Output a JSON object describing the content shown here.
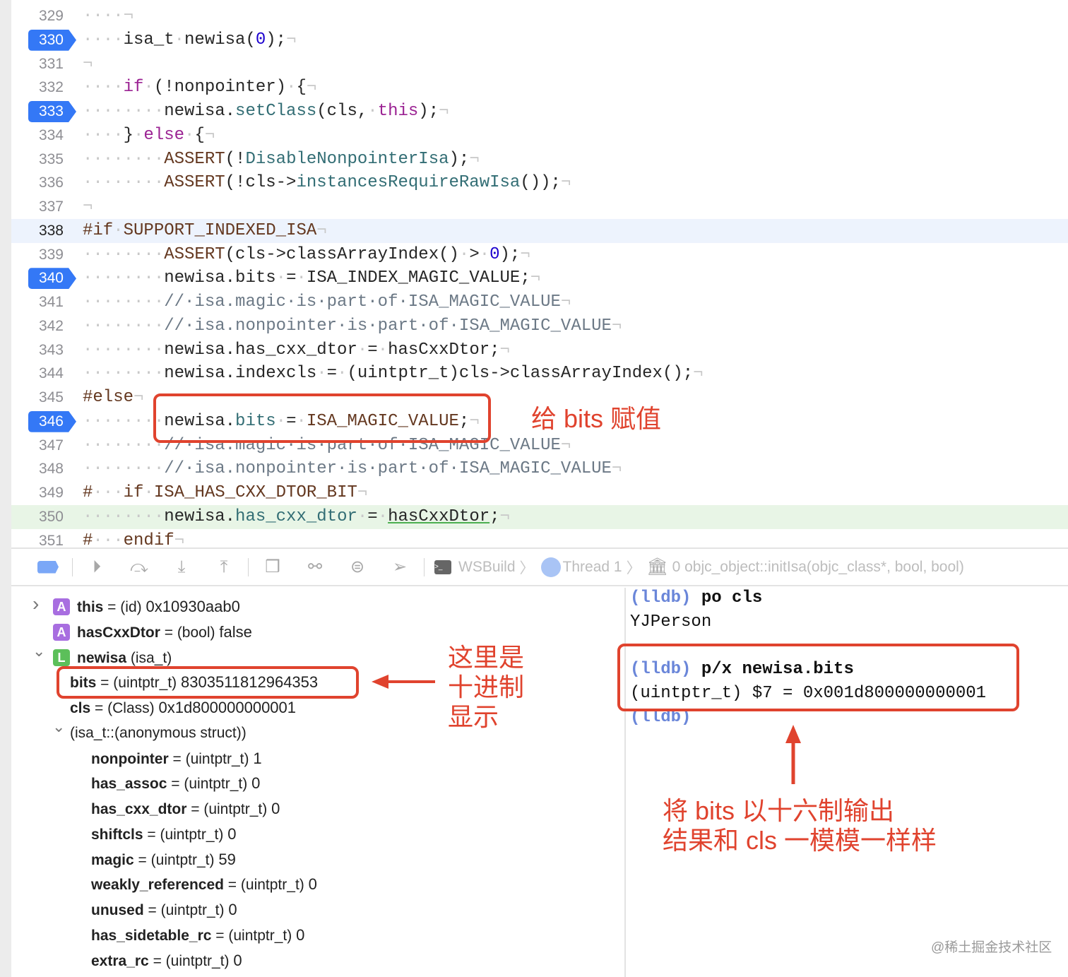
{
  "colors": {
    "accent": "#3478f6",
    "annotation": "#e0432e",
    "keyword": "#9b2393",
    "function": "#326d74",
    "number": "#1c00cf",
    "macro": "#643820",
    "comment": "#6c7986",
    "lldb_prompt": "#6a86d9"
  },
  "editor": {
    "lines": [
      {
        "n": "329",
        "t": [
          [
            "w",
            "····"
          ],
          [
            "e",
            "¬"
          ]
        ]
      },
      {
        "n": "330",
        "bp": true,
        "t": [
          [
            "w",
            "····"
          ],
          [
            "p",
            "isa_t"
          ],
          [
            "w",
            "·"
          ],
          [
            "p",
            "newisa("
          ],
          [
            "n",
            "0"
          ],
          [
            "p",
            ");"
          ],
          [
            "e",
            "¬"
          ]
        ]
      },
      {
        "n": "331",
        "t": [
          [
            "e",
            "¬"
          ]
        ]
      },
      {
        "n": "332",
        "t": [
          [
            "w",
            "····"
          ],
          [
            "k",
            "if"
          ],
          [
            "w",
            "·"
          ],
          [
            "p",
            "(!nonpointer)"
          ],
          [
            "w",
            "·"
          ],
          [
            "p",
            "{"
          ],
          [
            "e",
            "¬"
          ]
        ]
      },
      {
        "n": "333",
        "bp": true,
        "t": [
          [
            "w",
            "········"
          ],
          [
            "p",
            "newisa."
          ],
          [
            "f",
            "setClass"
          ],
          [
            "p",
            "(cls,"
          ],
          [
            "w",
            "·"
          ],
          [
            "k",
            "this"
          ],
          [
            "p",
            ");"
          ],
          [
            "e",
            "¬"
          ]
        ]
      },
      {
        "n": "334",
        "t": [
          [
            "w",
            "····"
          ],
          [
            "p",
            "}"
          ],
          [
            "w",
            "·"
          ],
          [
            "k",
            "else"
          ],
          [
            "w",
            "·"
          ],
          [
            "p",
            "{"
          ],
          [
            "e",
            "¬"
          ]
        ]
      },
      {
        "n": "335",
        "t": [
          [
            "w",
            "········"
          ],
          [
            "m",
            "ASSERT"
          ],
          [
            "p",
            "(!"
          ],
          [
            "f",
            "DisableNonpointerIsa"
          ],
          [
            "p",
            ");"
          ],
          [
            "e",
            "¬"
          ]
        ]
      },
      {
        "n": "336",
        "t": [
          [
            "w",
            "········"
          ],
          [
            "m",
            "ASSERT"
          ],
          [
            "p",
            "(!cls->"
          ],
          [
            "f",
            "instancesRequireRawIsa"
          ],
          [
            "p",
            "());"
          ],
          [
            "e",
            "¬"
          ]
        ]
      },
      {
        "n": "337",
        "t": [
          [
            "e",
            "¬"
          ]
        ]
      },
      {
        "n": "338",
        "hl": "blue",
        "cur": true,
        "t": [
          [
            "m",
            "#if"
          ],
          [
            "w",
            "·"
          ],
          [
            "m",
            "SUPPORT_INDEXED_ISA"
          ],
          [
            "e",
            "¬"
          ]
        ]
      },
      {
        "n": "339",
        "t": [
          [
            "w",
            "········"
          ],
          [
            "m",
            "ASSERT"
          ],
          [
            "p",
            "(cls->classArrayIndex()"
          ],
          [
            "w",
            "·"
          ],
          [
            "p",
            ">"
          ],
          [
            "w",
            "·"
          ],
          [
            "n",
            "0"
          ],
          [
            "p",
            ");"
          ],
          [
            "e",
            "¬"
          ]
        ]
      },
      {
        "n": "340",
        "bp": true,
        "t": [
          [
            "w",
            "········"
          ],
          [
            "p",
            "newisa.bits"
          ],
          [
            "w",
            "·"
          ],
          [
            "p",
            "="
          ],
          [
            "w",
            "·"
          ],
          [
            "p",
            "ISA_INDEX_MAGIC_VALUE;"
          ],
          [
            "e",
            "¬"
          ]
        ]
      },
      {
        "n": "341",
        "t": [
          [
            "w",
            "········"
          ],
          [
            "c",
            "//·isa.magic·is·part·of·ISA_MAGIC_VALUE"
          ],
          [
            "e",
            "¬"
          ]
        ]
      },
      {
        "n": "342",
        "t": [
          [
            "w",
            "········"
          ],
          [
            "c",
            "//·isa.nonpointer·is·part·of·ISA_MAGIC_VALUE"
          ],
          [
            "e",
            "¬"
          ]
        ]
      },
      {
        "n": "343",
        "t": [
          [
            "w",
            "········"
          ],
          [
            "p",
            "newisa.has_cxx_dtor"
          ],
          [
            "w",
            "·"
          ],
          [
            "p",
            "="
          ],
          [
            "w",
            "·"
          ],
          [
            "p",
            "hasCxxDtor;"
          ],
          [
            "e",
            "¬"
          ]
        ]
      },
      {
        "n": "344",
        "t": [
          [
            "w",
            "········"
          ],
          [
            "p",
            "newisa.indexcls"
          ],
          [
            "w",
            "·"
          ],
          [
            "p",
            "="
          ],
          [
            "w",
            "·"
          ],
          [
            "p",
            "(uintptr_t)cls->classArrayIndex();"
          ],
          [
            "e",
            "¬"
          ]
        ]
      },
      {
        "n": "345",
        "t": [
          [
            "m",
            "#else"
          ],
          [
            "e",
            "¬"
          ]
        ]
      },
      {
        "n": "346",
        "bp": true,
        "t": [
          [
            "w",
            "········"
          ],
          [
            "p",
            "newisa."
          ],
          [
            "f",
            "bits"
          ],
          [
            "w",
            "·"
          ],
          [
            "p",
            "="
          ],
          [
            "w",
            "·"
          ],
          [
            "m",
            "ISA_MAGIC_VALUE"
          ],
          [
            "p",
            ";"
          ],
          [
            "e",
            "¬"
          ]
        ]
      },
      {
        "n": "347",
        "t": [
          [
            "w",
            "········"
          ],
          [
            "c",
            "//·isa.magic·is·part·of·ISA_MAGIC_VALUE"
          ],
          [
            "e",
            "¬"
          ]
        ]
      },
      {
        "n": "348",
        "t": [
          [
            "w",
            "········"
          ],
          [
            "c",
            "//·isa.nonpointer·is·part·of·ISA_MAGIC_VALUE"
          ],
          [
            "e",
            "¬"
          ]
        ]
      },
      {
        "n": "349",
        "t": [
          [
            "m",
            "#"
          ],
          [
            "w",
            "···"
          ],
          [
            "m",
            "if"
          ],
          [
            "w",
            "·"
          ],
          [
            "m",
            "ISA_HAS_CXX_DTOR_BIT"
          ],
          [
            "e",
            "¬"
          ]
        ]
      },
      {
        "n": "350",
        "hl": "green",
        "t": [
          [
            "w",
            "········"
          ],
          [
            "p",
            "newisa."
          ],
          [
            "f",
            "has_cxx_dtor"
          ],
          [
            "w",
            "·"
          ],
          [
            "p",
            "="
          ],
          [
            "w",
            "·"
          ],
          [
            "u",
            "hasCxxDtor"
          ],
          [
            "p",
            ";"
          ],
          [
            "e",
            "¬"
          ]
        ]
      },
      {
        "n": "351",
        "t": [
          [
            "m",
            "#"
          ],
          [
            "w",
            "···"
          ],
          [
            "m",
            "endif"
          ],
          [
            "e",
            "¬"
          ]
        ]
      }
    ]
  },
  "toolbar": {
    "icons": [
      "breakpoints-toggle-icon",
      "continue-icon",
      "step-over-icon",
      "step-into-icon",
      "step-out-icon",
      "view-hierarchy-icon",
      "memory-graph-icon",
      "environment-overrides-icon",
      "simulate-location-icon"
    ],
    "target": "WSBuild",
    "thread": "Thread 1",
    "frame": "0 objc_object::initIsa(objc_class*, bool, bool)"
  },
  "variables": [
    {
      "level": 0,
      "disc": "›",
      "badge": "A",
      "badge_color": "#a86ee0",
      "name": "this",
      "type": "(id)",
      "value": "0x10930aab0"
    },
    {
      "level": 0,
      "badge": "A",
      "badge_color": "#a86ee0",
      "name": "hasCxxDtor",
      "type": "(bool)",
      "value": "false"
    },
    {
      "level": 0,
      "disc": "⌄",
      "badge": "L",
      "badge_color": "#5cbf5a",
      "name": "newisa",
      "type": "(isa_t)",
      "value": ""
    },
    {
      "level": 1,
      "name": "bits",
      "type": "(uintptr_t)",
      "value": "8303511812964353"
    },
    {
      "level": 1,
      "name": "cls",
      "type": "(Class)",
      "value": "0x1d800000000001"
    },
    {
      "level": 1,
      "disc": "⌄",
      "plain": "(isa_t::(anonymous struct))"
    },
    {
      "level": 2,
      "name": "nonpointer",
      "type": "(uintptr_t)",
      "value": "1"
    },
    {
      "level": 2,
      "name": "has_assoc",
      "type": "(uintptr_t)",
      "value": "0"
    },
    {
      "level": 2,
      "name": "has_cxx_dtor",
      "type": "(uintptr_t)",
      "value": "0"
    },
    {
      "level": 2,
      "name": "shiftcls",
      "type": "(uintptr_t)",
      "value": "0"
    },
    {
      "level": 2,
      "name": "magic",
      "type": "(uintptr_t)",
      "value": "59"
    },
    {
      "level": 2,
      "name": "weakly_referenced",
      "type": "(uintptr_t)",
      "value": "0"
    },
    {
      "level": 2,
      "name": "unused",
      "type": "(uintptr_t)",
      "value": "0"
    },
    {
      "level": 2,
      "name": "has_sidetable_rc",
      "type": "(uintptr_t)",
      "value": "0"
    },
    {
      "level": 2,
      "name": "extra_rc",
      "type": "(uintptr_t)",
      "value": "0"
    }
  ],
  "console": {
    "prompt": "(lldb)",
    "cmd1": "po cls",
    "out1": "YJPerson",
    "cmd2": "p/x newisa.bits",
    "out2": "(uintptr_t) $7 = 0x001d800000000001"
  },
  "annotations": {
    "code_note": "给 bits 赋值",
    "decimal_note": "这里是\n十进制\n显示",
    "hex_note": "将 bits 以十六制输出\n结果和 cls 一模模一样样"
  },
  "watermark": "@稀土掘金技术社区"
}
